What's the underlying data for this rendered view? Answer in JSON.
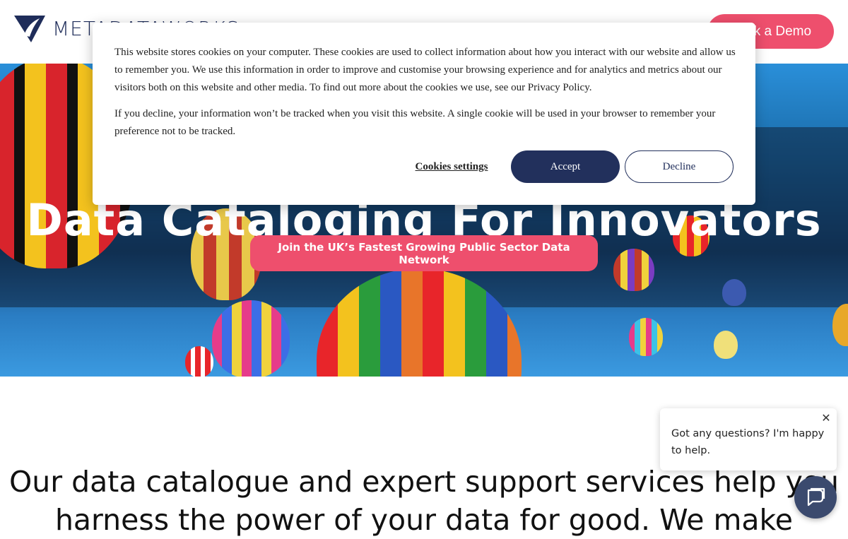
{
  "brand": {
    "name_part1": "METADATA",
    "name_part2": "WORKS",
    "accent_color": "#ee4f6d",
    "navy_color": "#22305c"
  },
  "header": {
    "demo_button_label": "Book a Demo"
  },
  "hero": {
    "title": "Data Cataloging For Innovators",
    "cta_label": "Join the UK’s Fastest Growing Public Sector Data Network"
  },
  "body": {
    "intro_text": "Our data catalogue and expert support services help you harness the power of your data for good. We make"
  },
  "cookie_banner": {
    "paragraph1": "This website stores cookies on your computer. These cookies are used to collect information about how you interact with our website and allow us to remember you. We use this information in order to improve and customise your browsing experience and for analytics and metrics about our visitors both on this website and other media. To find out more about the cookies we use, see our Privacy Policy.",
    "paragraph2": "If you decline, your information won’t be tracked when you visit this website. A single cookie will be used in your browser to remember your preference not to be tracked.",
    "settings_label": "Cookies settings",
    "accept_label": "Accept",
    "decline_label": "Decline"
  },
  "chat": {
    "message": "Got any questions? I'm happy to help.",
    "close_icon": "close-icon",
    "launcher_icon": "chat-icon"
  }
}
